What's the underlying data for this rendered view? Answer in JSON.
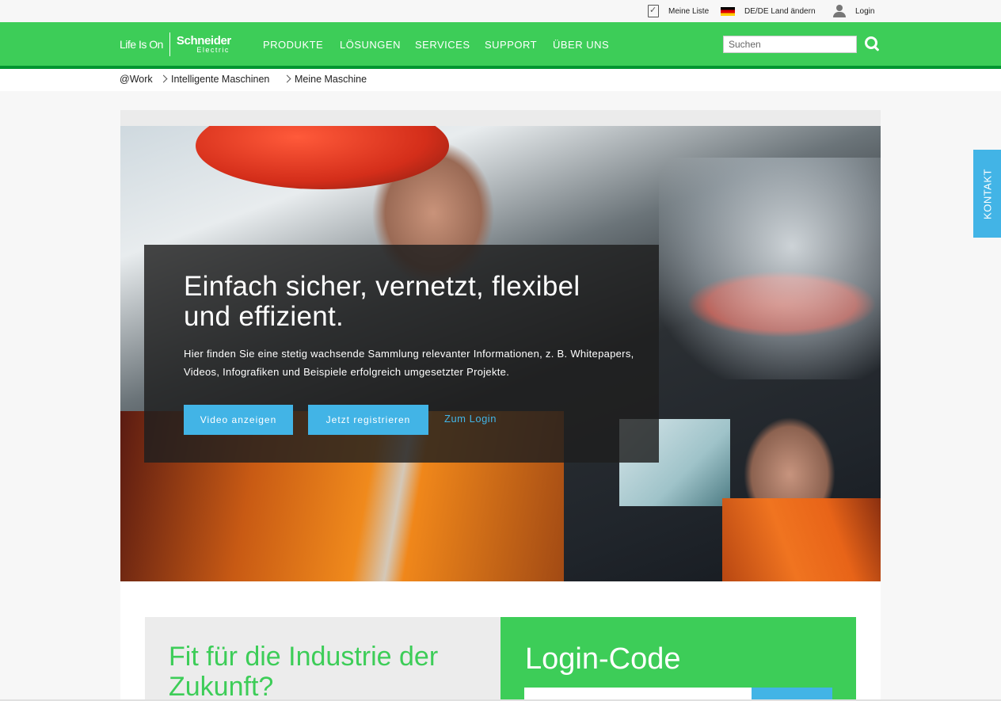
{
  "utility_bar": {
    "my_list": "Meine Liste",
    "country": "DE/DE Land ändern",
    "login": "Login"
  },
  "brand": {
    "tagline": "Life Is On",
    "name": "Schneider",
    "sub": "Electric"
  },
  "nav": {
    "items": [
      "PRODUKTE",
      "LÖSUNGEN",
      "SERVICES",
      "SUPPORT",
      "ÜBER UNS"
    ]
  },
  "search": {
    "placeholder": "Suchen"
  },
  "breadcrumb": [
    "@Work",
    "Intelligente Maschinen",
    "Meine Maschine"
  ],
  "hero": {
    "title": "Einfach sicher, vernetzt, flexibel und effizient.",
    "description": "Hier finden Sie eine stetig wachsende Sammlung relevanter Informationen, z. B. Whitepapers, Videos, Infografiken und Beispiele erfolgreich umgesetzter Projekte.",
    "video_button": "Video anzeigen",
    "register_button": "Jetzt registrieren",
    "login_link": "Zum Login"
  },
  "panels": {
    "left_title": "Fit für die Industrie der Zukunft?",
    "right_title": "Login-Code"
  },
  "side_tab": {
    "label": "KONTAKT"
  },
  "colors": {
    "brand_green": "#3dcd58",
    "dark_green": "#009530",
    "accent_blue": "#42b4e6"
  },
  "icons": [
    "list-check-icon",
    "german-flag-icon",
    "user-icon",
    "search-icon",
    "chevron-right-icon"
  ]
}
